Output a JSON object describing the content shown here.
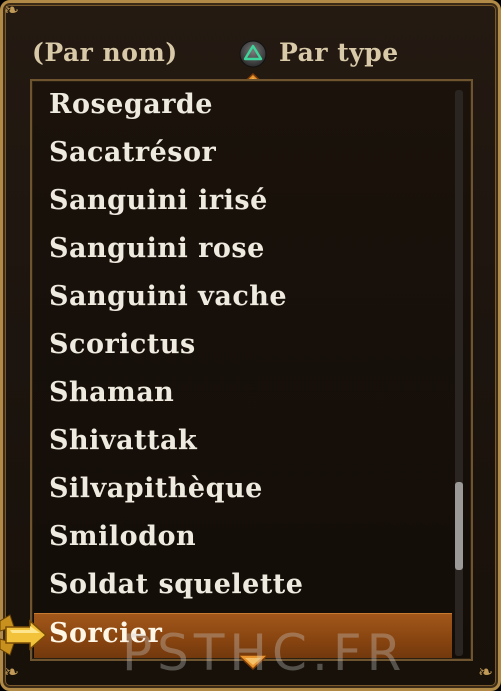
{
  "header": {
    "sort_by_name": "(Par nom)",
    "sort_by_type": "Par type",
    "toggle_button_icon": "triangle-button-icon"
  },
  "list": {
    "items": [
      "Rosegarde",
      "Sacatrésor",
      "Sanguini irisé",
      "Sanguini rose",
      "Sanguini vache",
      "Scorictus",
      "Shaman",
      "Shivattak",
      "Silvapithèque",
      "Smilodon",
      "Soldat squelette",
      "Sorcier"
    ],
    "selected_index": 11,
    "scroll_position_fraction": 0.82
  },
  "watermark": "PSTHC.FR",
  "colors": {
    "frame_gold": "#b08a46",
    "selection_orange": "#9a4f16",
    "text": "#eeeae0"
  }
}
